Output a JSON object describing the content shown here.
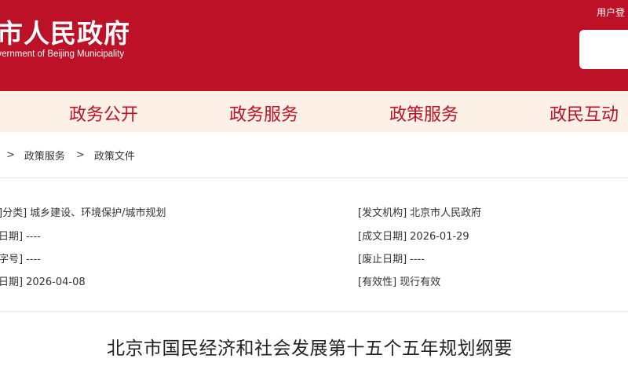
{
  "header": {
    "title": "市人民政府",
    "subtitle": "overnment of Beijing Municipality",
    "login_label": "用户登",
    "search_placeholder": ""
  },
  "nav": {
    "items": [
      {
        "label": "政务公开"
      },
      {
        "label": "政务服务"
      },
      {
        "label": "政策服务"
      },
      {
        "label": "政民互动"
      }
    ]
  },
  "breadcrumb": {
    "sep": ">",
    "items": [
      "政策服务",
      "政策文件"
    ]
  },
  "meta": {
    "left": [
      {
        "key": "]分类]",
        "value": "城乡建设、环境保护/城市规划"
      },
      {
        "key": "日期]",
        "value": "----"
      },
      {
        "key": "字号]",
        "value": "----"
      },
      {
        "key": "日期]",
        "value": "2026-04-08"
      }
    ],
    "right": [
      {
        "key": "[发文机构]",
        "value": "北京市人民政府"
      },
      {
        "key": "[成文日期]",
        "value": "2026-01-29"
      },
      {
        "key": "[废止日期]",
        "value": "----"
      },
      {
        "key": "[有效性]",
        "value": "现行有效"
      }
    ]
  },
  "document": {
    "title": "北京市国民经济和社会发展第十五个五年规划纲要"
  },
  "colors": {
    "brand_red": "#bc1126",
    "nav_bg": "#fdf0e6"
  }
}
